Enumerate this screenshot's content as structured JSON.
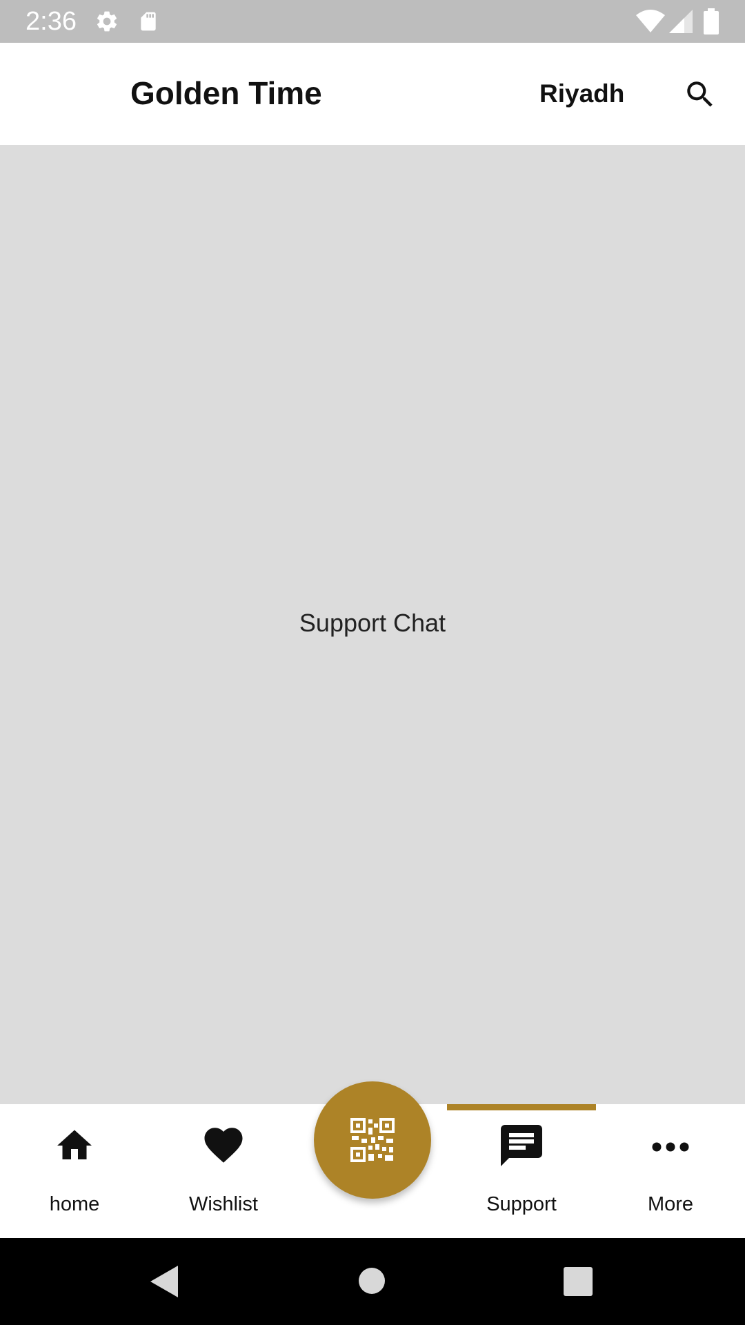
{
  "status_bar": {
    "time": "2:36",
    "icons": [
      "settings-icon",
      "sd-card-icon",
      "wifi-icon",
      "signal-icon",
      "battery-icon"
    ]
  },
  "app_bar": {
    "title": "Golden Time",
    "city": "Riyadh",
    "search_icon": "search-icon"
  },
  "main": {
    "text": "Support Chat"
  },
  "bottom_nav": {
    "items": [
      {
        "label": "home",
        "icon": "home-icon"
      },
      {
        "label": "Wishlist",
        "icon": "heart-icon"
      },
      {
        "label": "Support",
        "icon": "chat-icon",
        "active": true
      },
      {
        "label": "More",
        "icon": "more-icon"
      }
    ],
    "fab_icon": "qr-code-icon"
  },
  "system_nav": {
    "icons": [
      "back-icon",
      "home-circle-icon",
      "recents-icon"
    ]
  },
  "colors": {
    "accent": "#ad8327",
    "status_bar": "#bdbdbd",
    "background": "#dcdcdc"
  }
}
